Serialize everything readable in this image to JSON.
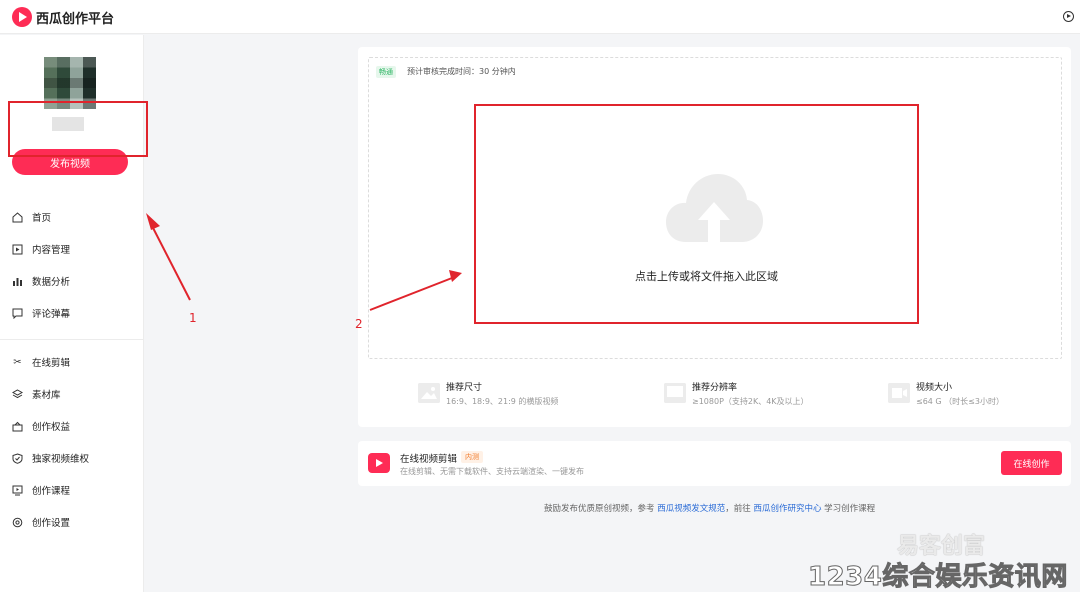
{
  "topbar": {
    "app_name": "西瓜创作平台"
  },
  "sidebar": {
    "publish_label": "发布视频",
    "items": [
      {
        "label": "首页",
        "icon": "home-icon"
      },
      {
        "label": "内容管理",
        "icon": "video-file-icon"
      },
      {
        "label": "数据分析",
        "icon": "bar-chart-icon"
      },
      {
        "label": "评论弹幕",
        "icon": "comment-icon"
      },
      {
        "label": "在线剪辑",
        "icon": "scissors-icon"
      },
      {
        "label": "素材库",
        "icon": "layers-icon"
      },
      {
        "label": "创作权益",
        "icon": "gift-icon"
      },
      {
        "label": "独家视频维权",
        "icon": "shield-icon"
      },
      {
        "label": "创作课程",
        "icon": "course-icon"
      },
      {
        "label": "创作设置",
        "icon": "settings-icon"
      }
    ]
  },
  "upload": {
    "badge": "畅通",
    "review_time": "预计审核完成时间：30 分钟内",
    "prompt": "点击上传或将文件拖入此区域",
    "specs": [
      {
        "title": "推荐尺寸",
        "sub": "16:9、18:9、21:9 的横版视频",
        "icon": "image-icon"
      },
      {
        "title": "推荐分辨率",
        "sub": "≥1080P（支持2K、4K及以上）",
        "icon": "monitor-icon"
      },
      {
        "title": "视频大小",
        "sub": "≤64 G （时长≤3小时）",
        "icon": "video-size-icon"
      }
    ]
  },
  "editor": {
    "title": "在线视频剪辑",
    "tag": "内测",
    "sub": "在线剪辑、无需下载软件、支持云端渲染、一键发布",
    "button": "在线创作"
  },
  "footer": {
    "prefix": "鼓励发布优质原创视频，参考",
    "link1": "西瓜视频发文规范",
    "middle": "，前往",
    "link2": "西瓜创作研究中心",
    "suffix": "学习创作课程"
  },
  "annotations": {
    "num1": "1",
    "num2": "2"
  },
  "watermark": {
    "logo": "易客创富",
    "banner": "1234综合娱乐资讯网"
  },
  "colors": {
    "brand": "#fe2c55",
    "annotation": "#e0242c",
    "link": "#2a6bd6"
  }
}
